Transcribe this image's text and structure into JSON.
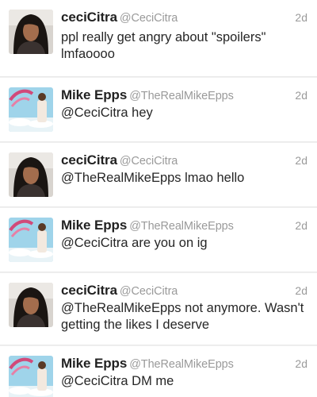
{
  "tweets": [
    {
      "name": "ceciCitra",
      "handle": "@CeciCitra",
      "time": "2d",
      "lines": [
        "ppl really get angry about \"spoilers\"",
        "lmfaoooo"
      ],
      "avatar_icon": "woman-portrait-avatar"
    },
    {
      "name": "Mike Epps",
      "handle": "@TheRealMikeEpps",
      "time": "2d",
      "lines": [
        "@CeciCitra hey"
      ],
      "avatar_icon": "album-art-avatar"
    },
    {
      "name": "ceciCitra",
      "handle": "@CeciCitra",
      "time": "2d",
      "lines": [
        "@TheRealMikeEpps lmao hello"
      ],
      "avatar_icon": "woman-portrait-avatar"
    },
    {
      "name": "Mike Epps",
      "handle": "@TheRealMikeEpps",
      "time": "2d",
      "lines": [
        "@CeciCitra are you on ig"
      ],
      "avatar_icon": "album-art-avatar"
    },
    {
      "name": "ceciCitra",
      "handle": "@CeciCitra",
      "time": "2d",
      "lines": [
        "@TheRealMikeEpps not anymore. Wasn't",
        "getting the likes I deserve"
      ],
      "avatar_icon": "woman-portrait-avatar"
    },
    {
      "name": "Mike Epps",
      "handle": "@TheRealMikeEpps",
      "time": "2d",
      "lines": [
        "@CeciCitra DM me"
      ],
      "avatar_icon": "album-art-avatar"
    }
  ],
  "colors": {
    "name": "#222222",
    "handle": "#9a9a9a",
    "text": "#262626",
    "divider": "#e6e6e6"
  }
}
